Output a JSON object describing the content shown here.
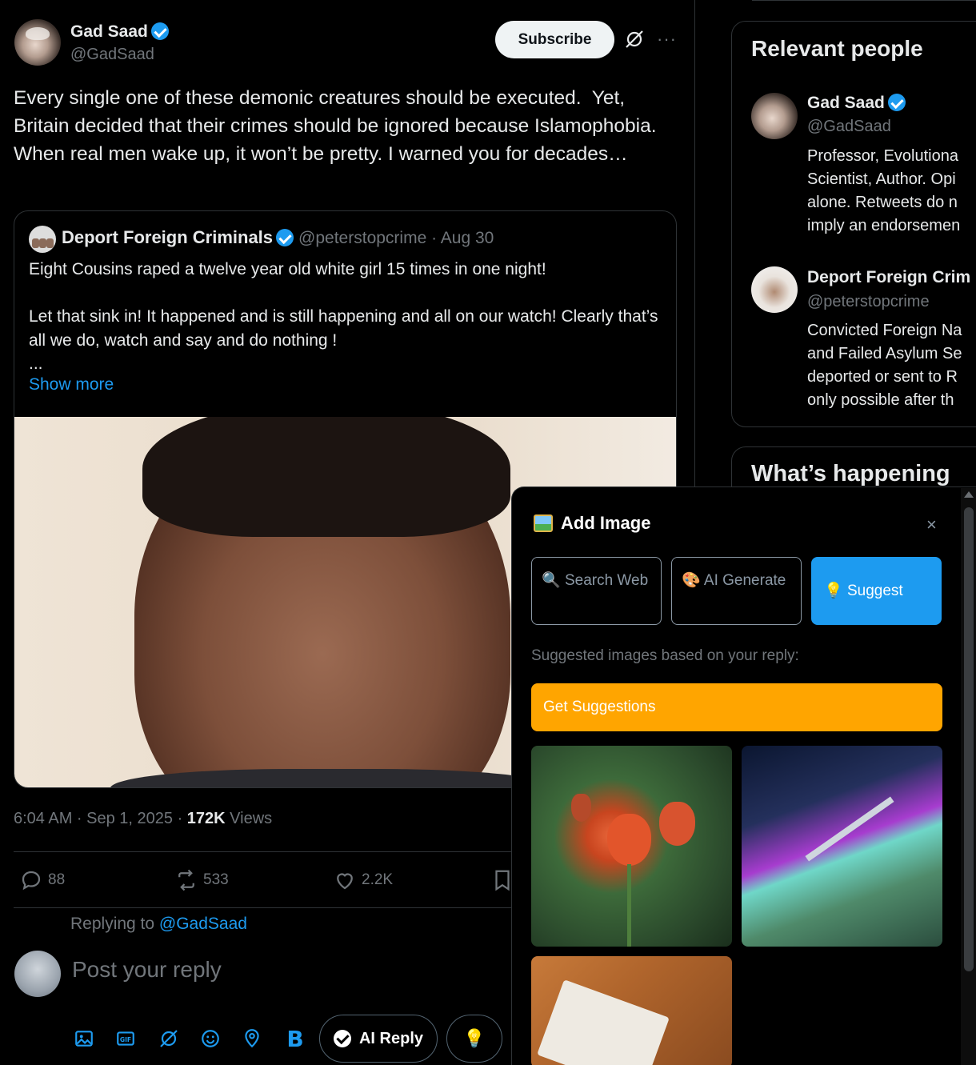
{
  "tweet": {
    "author_name": "Gad Saad",
    "author_handle": "@GadSaad",
    "subscribe_label": "Subscribe",
    "text": "Every single one of these demonic creatures should be executed.  Yet, Britain decided that their crimes should be ignored because Islamophobia. When real men wake up, it won’t be pretty. I warned you for decades…",
    "timestamp": "6:04 AM · Sep 1, 2025 · ",
    "views_count": "172K",
    "views_label": " Views",
    "stats": {
      "replies": "88",
      "retweets": "533",
      "likes": "2.2K"
    }
  },
  "quote": {
    "name": "Deport Foreign Criminals",
    "meta": "@peterstopcrime · Aug 30",
    "text": "Eight Cousins raped a twelve year old white girl 15 times in one night!\n\nLet that sink in! It happened and is still happening and all on our watch! Clearly that’s all we do, watch and say and do nothing !\n...",
    "show_more": "Show more"
  },
  "reply": {
    "replying_prefix": "Replying to ",
    "replying_handle": "@GadSaad",
    "placeholder": "Post your reply",
    "bold_label": "B",
    "ai_reply_label": "AI Reply",
    "bulb": "💡"
  },
  "sidebar": {
    "relevant_title": "Relevant people",
    "people": [
      {
        "name": "Gad Saad",
        "handle": "@GadSaad",
        "bio": "Professor, Evolutiona\nScientist, Author. Opi\nalone. Retweets do n\nimply an endorsemen"
      },
      {
        "name": "Deport Foreign Crim",
        "handle": "@peterstopcrime",
        "bio": "Convicted Foreign Na\nand Failed Asylum Se\ndeported or sent to R\nonly possible after th"
      }
    ],
    "whats_happening": "What’s happening"
  },
  "add_image": {
    "title": "Add Image",
    "close": "×",
    "search_web_icon": "🔍",
    "search_web": "Search Web",
    "ai_generate_icon": "🎨",
    "ai_generate": "AI Generate",
    "suggest_icon": "💡",
    "suggest": "Suggest",
    "subtitle": "Suggested images based on your reply:",
    "get_suggestions": "Get Suggestions"
  },
  "colors": {
    "accent": "#1d9bf0",
    "orange": "#ffa500",
    "bg": "#000000"
  }
}
